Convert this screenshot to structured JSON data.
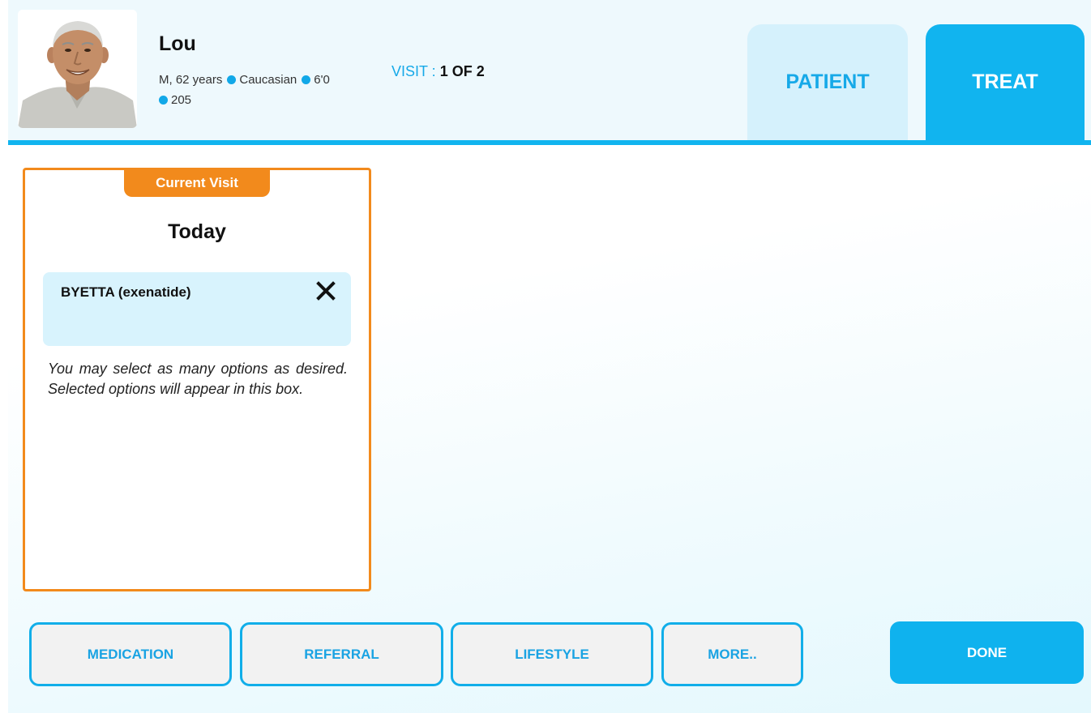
{
  "patient": {
    "name": "Lou",
    "sex_age": "M, 62 years",
    "ethnicity": "Caucasian",
    "height": "6'0",
    "weight": "205",
    "visit_label": "VISIT :",
    "visit_value": "1 OF 2"
  },
  "tabs": [
    {
      "label": "PATIENT",
      "active": false
    },
    {
      "label": "TREAT",
      "active": true
    }
  ],
  "current_visit": {
    "badge": "Current Visit",
    "day": "Today",
    "selected_items": [
      {
        "label": "BYETTA (exenatide)",
        "remove_icon": "close-icon"
      }
    ],
    "hint": "You may select as many options as desired. Selected options will appear in this box."
  },
  "actions": {
    "medication": "MEDICATION",
    "referral": "REFERRAL",
    "lifestyle": "LIFESTYLE",
    "more": "MORE..",
    "done": "DONE"
  },
  "colors": {
    "accent": "#11b4ef",
    "visit_border": "#f28a1c",
    "tab_inactive": "#d5f1fc",
    "selected_bg": "#d8f3fd"
  }
}
